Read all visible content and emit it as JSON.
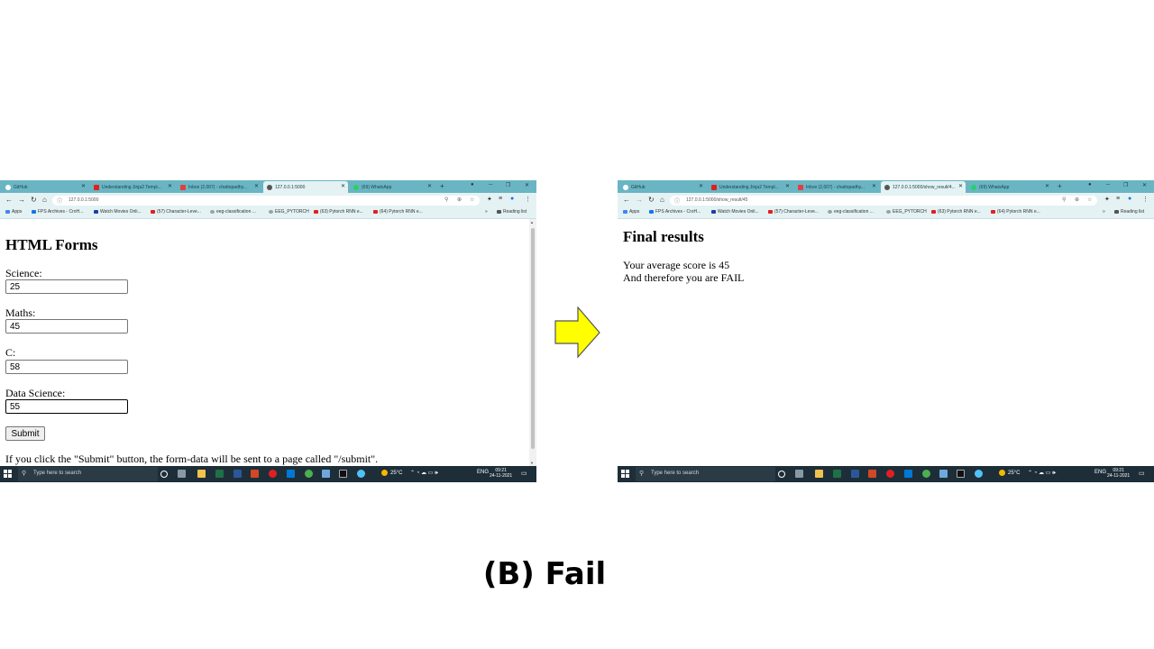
{
  "tabs": {
    "github": "GitHub",
    "jinja": "Understanding Jinja2 Templ...",
    "inbox": "Inbox (2,007) - chattopadhy...",
    "local": "127.0.0.1:5000",
    "local_result": "127.0.0.1:5000/show_result/4...",
    "whatsapp": "(69) WhatsApp"
  },
  "bookmarks": {
    "apps": "Apps",
    "fps": "FPS Archives - CroH...",
    "movies": "Watch Movies Onli...",
    "charlevel": "(57) Character-Leve...",
    "eeg": "eeg-classification ...",
    "eegpytorch": "EEG_PYTORCH",
    "rnn63": "(63) Pytorch RNN e...",
    "rnn64": "(64) Pytorch RNN e...",
    "more": "»",
    "reading": "Reading list"
  },
  "left": {
    "url": "127.0.0.1:5000",
    "title": "HTML Forms",
    "science_label": "Science:",
    "science_value": "25",
    "maths_label": "Maths:",
    "maths_value": "45",
    "c_label": "C:",
    "c_value": "58",
    "ds_label": "Data Science:",
    "ds_value": "55",
    "submit": "Submit",
    "note": "If you click the \"Submit\" button, the form-data will be sent to a page called \"/submit\"."
  },
  "right": {
    "url": "127.0.0.1:5000/show_result/45",
    "title": "Final results",
    "line1": "Your average score is 45",
    "line2": "And therefore you are FAIL"
  },
  "taskbar": {
    "search_placeholder": "Type here to search",
    "temperature": "25°C",
    "lang": "ENG",
    "time": "09:21",
    "date": "24-11-2021"
  },
  "caption": "(B) Fail",
  "colors": {
    "tabstrip": "#6ab5c3",
    "toolbar": "#e4f2f4",
    "taskbar": "#1e2e38",
    "arrow_fill": "#ffff00"
  }
}
